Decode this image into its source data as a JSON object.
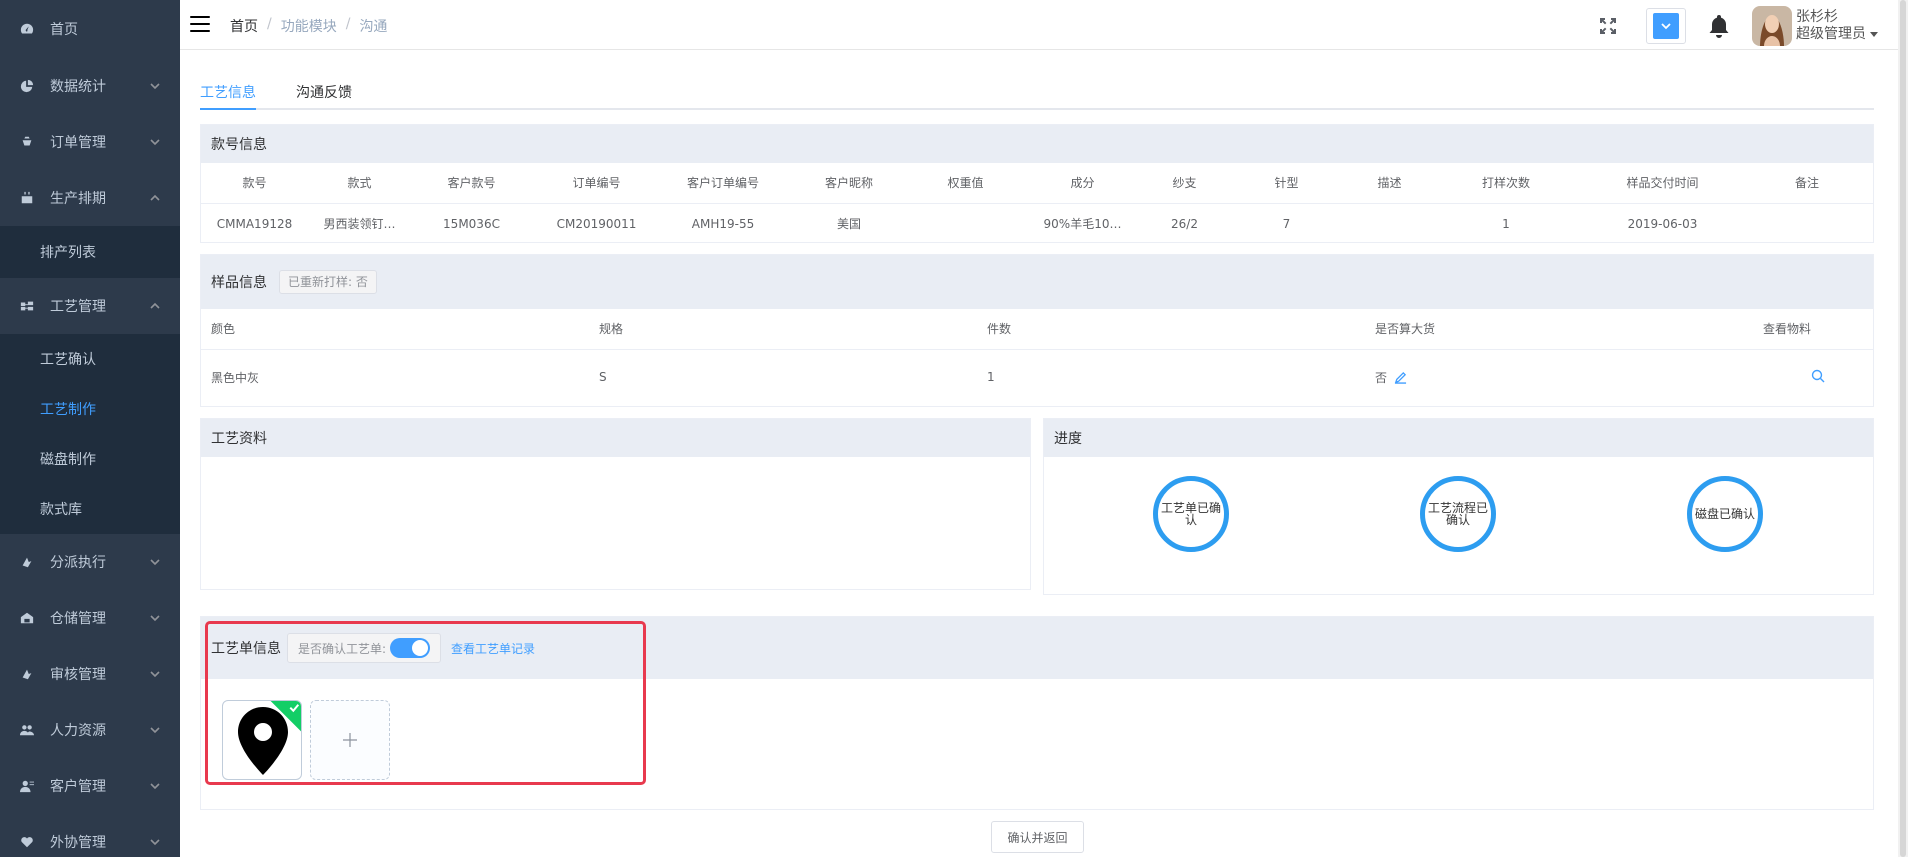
{
  "sidebar": {
    "items": [
      {
        "label": "首页",
        "icon": "dashboard-icon",
        "expandable": false
      },
      {
        "label": "数据统计",
        "icon": "pie-chart-icon",
        "expandable": true
      },
      {
        "label": "订单管理",
        "icon": "order-icon",
        "expandable": true
      },
      {
        "label": "生产排期",
        "icon": "calendar-icon",
        "expandable": true,
        "open": true,
        "children": [
          "排产列表"
        ]
      },
      {
        "label": "工艺管理",
        "icon": "process-icon",
        "expandable": true,
        "open": true,
        "children": [
          "工艺确认",
          "工艺制作",
          "磁盘制作",
          "款式库"
        ],
        "active_child": "工艺制作"
      },
      {
        "label": "分派执行",
        "icon": "dispatch-icon",
        "expandable": true
      },
      {
        "label": "仓储管理",
        "icon": "warehouse-icon",
        "expandable": true
      },
      {
        "label": "审核管理",
        "icon": "audit-icon",
        "expandable": true
      },
      {
        "label": "人力资源",
        "icon": "people-icon",
        "expandable": true
      },
      {
        "label": "客户管理",
        "icon": "customer-icon",
        "expandable": true
      },
      {
        "label": "外协管理",
        "icon": "outsource-icon",
        "expandable": true
      }
    ]
  },
  "header": {
    "breadcrumb": [
      "首页",
      "功能模块",
      "沟通"
    ],
    "user_name": "张杉杉",
    "user_role": "超级管理员",
    "theme_color": "#409eff"
  },
  "tabs": [
    {
      "label": "工艺信息",
      "active": true
    },
    {
      "label": "沟通反馈",
      "active": false
    }
  ],
  "style_info": {
    "title": "款号信息",
    "columns": [
      "款号",
      "款式",
      "客户款号",
      "订单编号",
      "客户订单编号",
      "客户昵称",
      "权重值",
      "成分",
      "纱支",
      "针型",
      "描述",
      "打样次数",
      "样品交付时间",
      "备注"
    ],
    "row": [
      "CMMA19128",
      "男西装领钉…",
      "15M036C",
      "CM20190011",
      "AMH19-55",
      "美国",
      "",
      "90%羊毛10…",
      "26/2",
      "7",
      "",
      "1",
      "2019-06-03",
      ""
    ]
  },
  "sample_info": {
    "title": "样品信息",
    "tag": "已重新打样:  否",
    "columns": [
      "颜色",
      "规格",
      "件数",
      "是否算大货",
      "查看物料"
    ],
    "row": [
      "黑色中灰",
      "S",
      "1",
      "否",
      ""
    ]
  },
  "process_material": {
    "title": "工艺资料"
  },
  "progress": {
    "title": "进度",
    "steps": [
      "工艺单已确认",
      "工艺流程已确认",
      "磁盘已确认"
    ]
  },
  "process_sheet": {
    "title": "工艺单信息",
    "confirm_label": "是否确认工艺单:",
    "confirmed": true,
    "record_link": "查看工艺单记录"
  },
  "footer": {
    "confirm_button": "确认并返回"
  }
}
